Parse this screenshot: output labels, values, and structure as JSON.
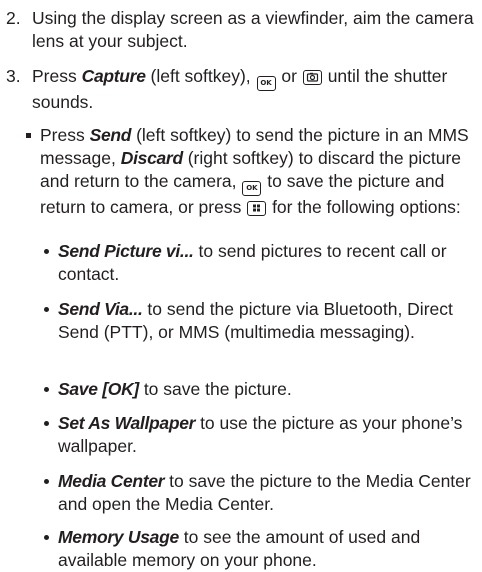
{
  "steps": [
    {
      "number": "2.",
      "text": "Using the display screen as a viewfinder, aim the camera lens at your subject."
    },
    {
      "number": "3.",
      "t1": "Press ",
      "capture": "Capture",
      "t2": " (left softkey), ",
      "t3": " or ",
      "t4": " until the shutter sounds."
    }
  ],
  "sub": {
    "t1": "Press ",
    "send": "Send",
    "t2": " (left softkey) to send the picture in an MMS message, ",
    "discard": "Discard",
    "t3": " (right softkey) to discard the picture and return to the camera, ",
    "t4": " to save the picture and return to camera, or press ",
    "t5": " for the following options:"
  },
  "options": [
    {
      "label": "Send Picture vi...",
      "desc": " to send pictures to recent call or contact."
    },
    {
      "label": "Send Via...",
      "desc": " to send the picture via Bluetooth, Direct Send (PTT), or MMS (multimedia messaging)."
    },
    {
      "label": "Save [OK]",
      "desc": " to save the picture."
    },
    {
      "label": "Set As Wallpaper",
      "desc": " to use the picture as your phone’s wallpaper."
    },
    {
      "label": "Media Center",
      "desc": " to save the picture to the Media Center and open the Media Center."
    },
    {
      "label": "Memory Usage",
      "desc": " to see the amount of used and available memory on your phone."
    }
  ],
  "icons": {
    "ok_key": "ok-key-icon",
    "camera_key": "camera-key-icon",
    "menu_key": "menu-key-icon"
  }
}
